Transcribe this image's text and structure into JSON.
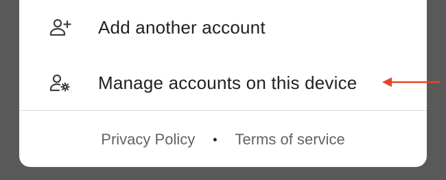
{
  "menu": {
    "items": [
      {
        "label": "Add another account",
        "icon": "person-add-icon"
      },
      {
        "label": "Manage accounts on this device",
        "icon": "manage-accounts-icon"
      }
    ]
  },
  "footer": {
    "privacy_label": "Privacy Policy",
    "separator": "•",
    "terms_label": "Terms of service"
  },
  "annotation": {
    "arrow_color": "#e8442b"
  },
  "colors": {
    "sheet_background": "#ffffff",
    "backdrop": "#595959",
    "text_primary": "#202124",
    "text_secondary": "#5f6368"
  }
}
